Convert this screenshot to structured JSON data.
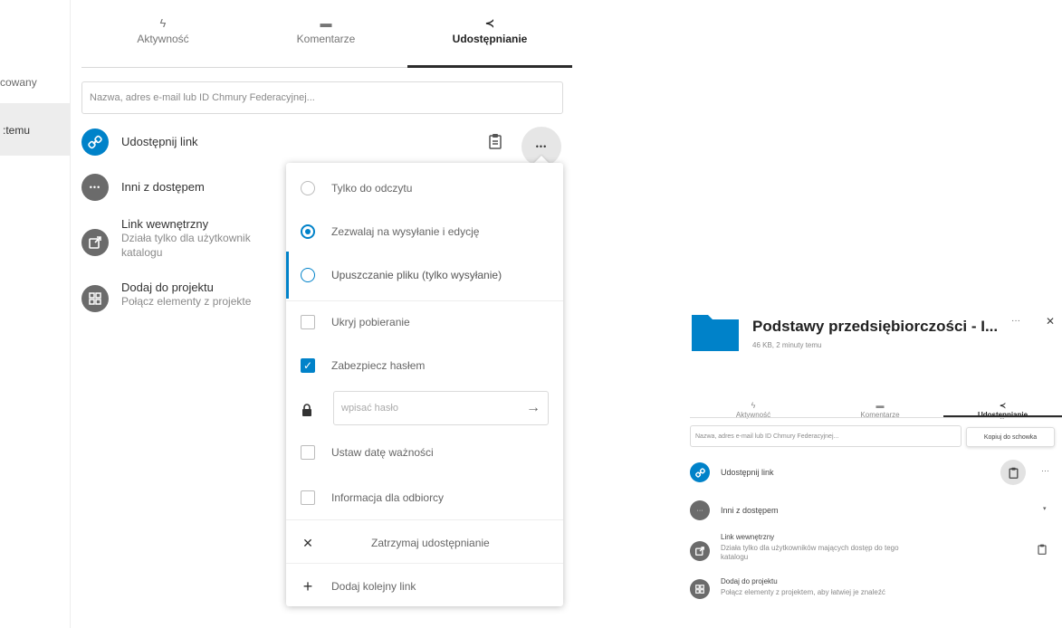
{
  "left_strip": {
    "item_top": "cowany",
    "item_selected": ":temu"
  },
  "main": {
    "tabs": [
      {
        "label": "Aktywność",
        "icon": "bolt-icon",
        "glyph": "ϟ"
      },
      {
        "label": "Komentarze",
        "icon": "comment-icon",
        "glyph": "▬"
      },
      {
        "label": "Udostępnianie",
        "icon": "share-icon",
        "glyph": "≺"
      }
    ],
    "search_placeholder": "Nazwa, adres e-mail lub ID Chmury Federacyjnej...",
    "share_link_label": "Udostępnij link",
    "others_label": "Inni z dostępem",
    "internal_link_title": "Link wewnętrzny",
    "internal_link_sub1": "Działa tylko dla użytkownik",
    "internal_link_sub2": "katalogu",
    "project_title": "Dodaj do projektu",
    "project_sub": "Połącz elementy z projekte",
    "more_glyph": "•••"
  },
  "dropdown": {
    "read_only": "Tylko do odczytu",
    "allow_upload_edit": "Zezwalaj na wysyłanie i edycję",
    "file_drop": "Upuszczanie pliku (tylko wysyłanie)",
    "hide_download": "Ukryj pobieranie",
    "password_protect": "Zabezpiecz hasłem",
    "password_placeholder": "wpisać hasło",
    "set_expiration": "Ustaw datę ważności",
    "note_recipient": "Informacja dla odbiorcy",
    "stop_sharing": "Zatrzymaj udostępnianie",
    "add_link": "Dodaj kolejny link",
    "check_glyph": "✓",
    "arrow_glyph": "→",
    "close_glyph": "✕",
    "plus_glyph": "+"
  },
  "mini_panel": {
    "title": "Podstawy przedsiębiorczości - I...",
    "meta": "46 KB, 2 minuty temu",
    "more_glyph": "···",
    "close_glyph": "✕",
    "tabs": [
      {
        "label": "Aktywność",
        "glyph": "ϟ"
      },
      {
        "label": "Komentarze",
        "glyph": "▬"
      },
      {
        "label": "Udostępnianie",
        "glyph": "≺"
      }
    ],
    "search_placeholder": "Nazwa, adres e-mail lub ID Chmury Federacyjnej...",
    "tooltip": "Kopiuj do schowka",
    "share_link_label": "Udostępnij link",
    "others_label": "Inni z dostępem",
    "others_caret": "▾",
    "internal_link_title": "Link wewnętrzny",
    "internal_link_sub1": "Działa tylko dla użytkowników mających dostęp do tego",
    "internal_link_sub2": "katalogu",
    "project_title": "Dodaj do projektu",
    "project_sub": "Połącz elementy z projektem, aby łatwiej je znaleźć"
  },
  "colors": {
    "accent": "#0082c9",
    "folder": "#0082c9",
    "avatar_gray": "#6b6b6b"
  }
}
